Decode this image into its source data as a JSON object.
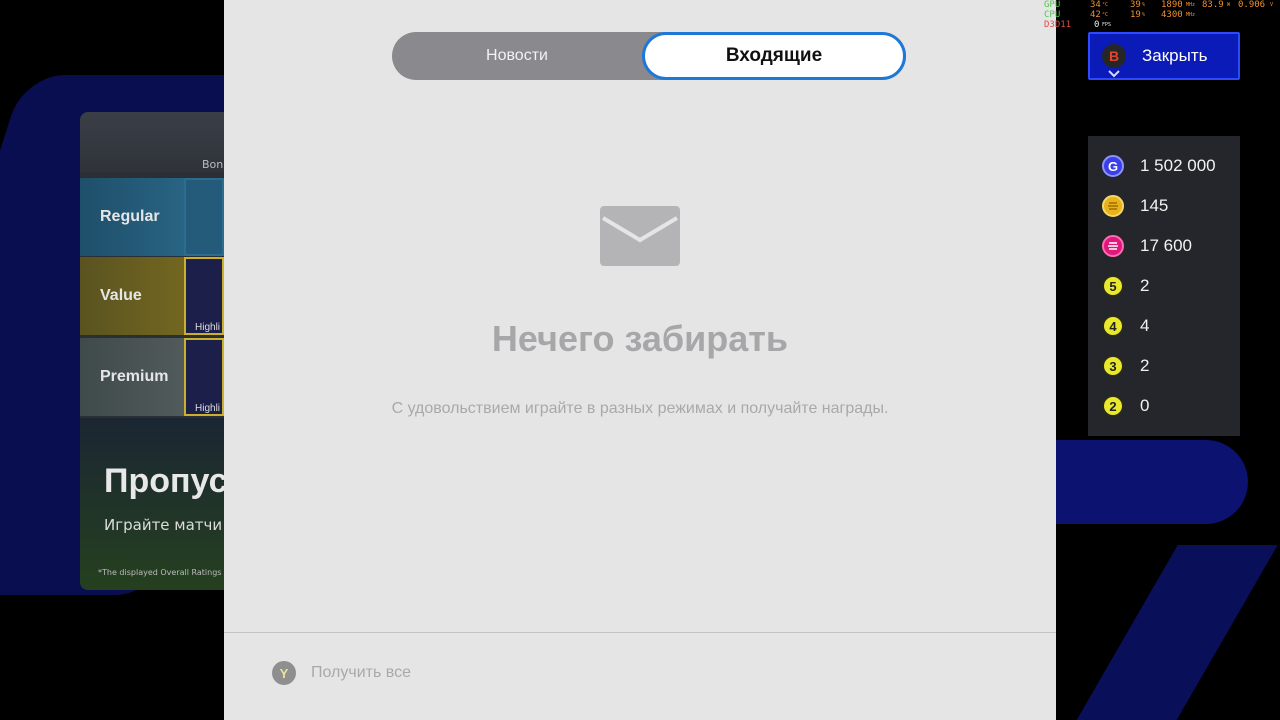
{
  "background": {
    "panel_header": "Bonu",
    "cards": [
      {
        "label": "Regular",
        "thumb_label": ""
      },
      {
        "label": "Value",
        "thumb_label": "Highli"
      },
      {
        "label": "Premium",
        "thumb_label": "Highli"
      }
    ],
    "promo": {
      "title": "Пропус",
      "subtitle": "Играйте матчи",
      "note": "*The displayed Overall Ratings re"
    }
  },
  "modal": {
    "tabs": [
      {
        "label": "Новости",
        "active": false
      },
      {
        "label": "Входящие",
        "active": true
      }
    ],
    "empty_title": "Нечего забирать",
    "empty_subtitle": "С удовольствием играйте в разных режимах и получайте награды.",
    "footer": {
      "button_key": "Y",
      "claim_all_label": "Получить все"
    }
  },
  "perf_overlay": {
    "row1": {
      "label": "GPU",
      "temp": "34",
      "temp_unit": "°C",
      "load": "39",
      "load_unit": "%",
      "clock": "1890",
      "clock_unit": "MHz",
      "power": "83.9",
      "power_unit": "W",
      "voltage": "0.906",
      "voltage_unit": "V"
    },
    "row2": {
      "label": "CPU",
      "temp": "42",
      "temp_unit": "°C",
      "load": "19",
      "load_unit": "%",
      "clock": "4300",
      "clock_unit": "MHz"
    },
    "row3": {
      "label": "D3D11",
      "fps": "0",
      "fps_unit": "FPS"
    }
  },
  "close_button": {
    "key": "B",
    "label": "Закрыть"
  },
  "currencies": [
    {
      "icon": "gp-coin-icon",
      "symbol": "G",
      "value": "1 502 000",
      "color": "#3b3fe6"
    },
    {
      "icon": "efootball-coin-icon",
      "symbol": "",
      "value": "145",
      "color": "#e8b21a"
    },
    {
      "icon": "efootball-point-icon",
      "symbol": "",
      "value": "17 600",
      "color": "#e0187a"
    },
    {
      "icon": "ticket-5-icon",
      "symbol": "5",
      "value": "2",
      "color": "#e9e82a"
    },
    {
      "icon": "ticket-4-icon",
      "symbol": "4",
      "value": "4",
      "color": "#e9e82a"
    },
    {
      "icon": "ticket-3-icon",
      "symbol": "3",
      "value": "2",
      "color": "#e9e82a"
    },
    {
      "icon": "ticket-2-icon",
      "symbol": "2",
      "value": "0",
      "color": "#e9e82a"
    }
  ]
}
